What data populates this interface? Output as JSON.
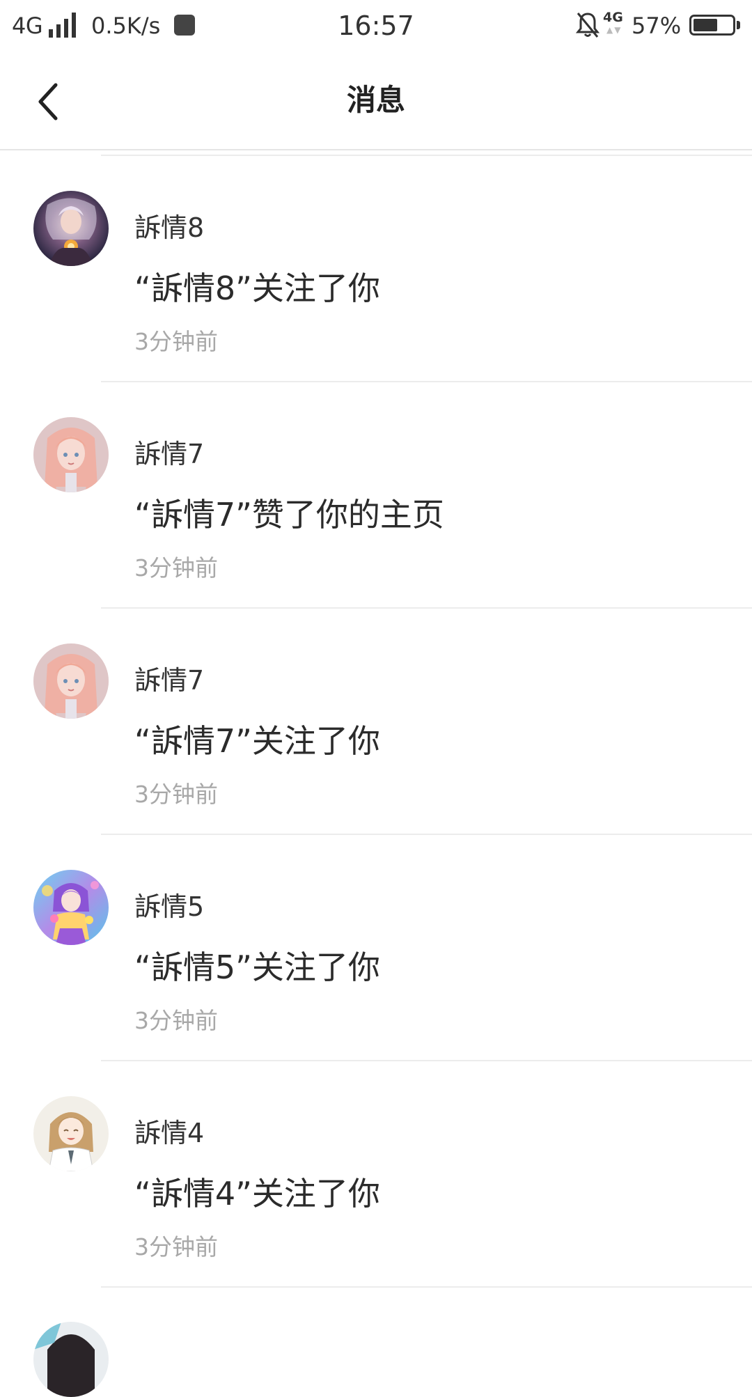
{
  "status_bar": {
    "network": "4G",
    "speed": "0.5K/s",
    "time": "16:57",
    "network2": "4G",
    "battery": "57%",
    "battery_level": 0.57
  },
  "header": {
    "title": "消息"
  },
  "messages": [
    {
      "name": "訴情8",
      "text": "“訴情8”关注了你",
      "time": "3分钟前"
    },
    {
      "name": "訴情7",
      "text": "“訴情7”赞了你的主页",
      "time": "3分钟前"
    },
    {
      "name": "訴情7",
      "text": "“訴情7”关注了你",
      "time": "3分钟前"
    },
    {
      "name": "訴情5",
      "text": "“訴情5”关注了你",
      "time": "3分钟前"
    },
    {
      "name": "訴情4",
      "text": "“訴情4”关注了你",
      "time": "3分钟前"
    }
  ]
}
